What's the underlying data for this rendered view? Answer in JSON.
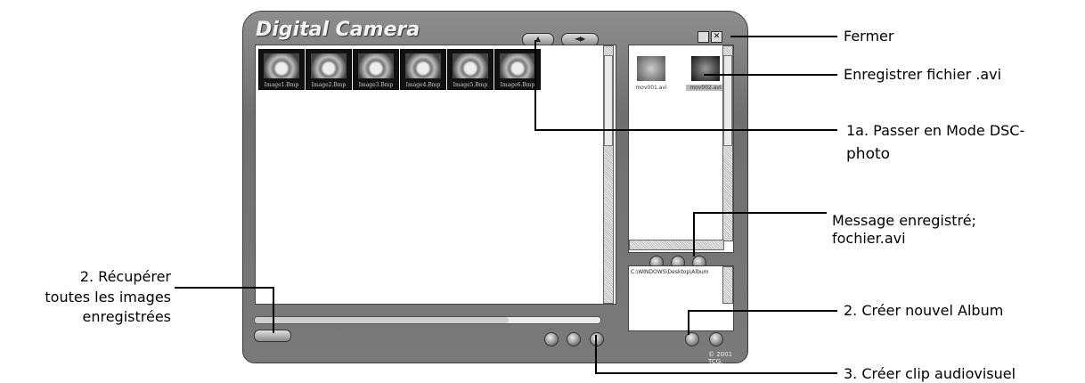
{
  "app": {
    "title": "Digital Camera",
    "copyright": "© 2001 TCG.",
    "gallery_images": [
      "Image1.Bmp",
      "Image2.Bmp",
      "Image3.Bmp",
      "Image4.Bmp",
      "Image5.Bmp",
      "Image6.Bmp"
    ],
    "video_files": [
      "mov001.avi",
      "mov002.avi"
    ],
    "album_path": "C:\\WINDOWS\\Desktop\\Album"
  },
  "callouts": {
    "close": "Fermer",
    "save_avi": "Enregistrer fichier .avi",
    "dsc_mode_line1": "1a. Passer en Mode DSC-",
    "dsc_mode_line2": "photo",
    "message_line1": "Message enregistré;",
    "message_line2": "fochier.avi",
    "retrieve_line1": "2. Récupérer",
    "retrieve_line2": "toutes les images",
    "retrieve_line3": "enregistrées",
    "new_album": "2. Créer nouvel Album",
    "create_clip": "3. Créer clip audiovisuel"
  }
}
